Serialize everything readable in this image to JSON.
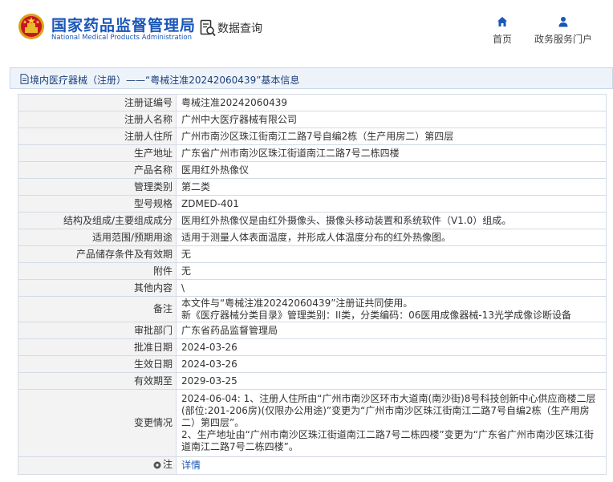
{
  "header": {
    "logo_cn": "国家药品监督管理局",
    "logo_en": "National Medical Products Administration",
    "query_label": "数据查询",
    "nav": [
      {
        "label": "首页",
        "icon": "home-icon"
      },
      {
        "label": "政务服务门户",
        "icon": "user-icon"
      }
    ]
  },
  "breadcrumb": {
    "text": "境内医疗器械（注册）——“粤械注准20242060439”基本信息",
    "icon": "document-icon"
  },
  "colors": {
    "brand": "#1a56b8",
    "crumb_bg": "#eef3fa",
    "key_bg": "#f3f3f3"
  },
  "rows": [
    {
      "key": "注册证编号",
      "value": "粤械注准20242060439"
    },
    {
      "key": "注册人名称",
      "value": "广州中大医疗器械有限公司"
    },
    {
      "key": "注册人住所",
      "value": "广州市南沙区珠江街南江二路7号自编2栋（生产用房二）第四层"
    },
    {
      "key": "生产地址",
      "value": "广东省广州市南沙区珠江街道南江二路7号二栋四楼"
    },
    {
      "key": "产品名称",
      "value": "医用红外热像仪"
    },
    {
      "key": "管理类别",
      "value": "第二类"
    },
    {
      "key": "型号规格",
      "value": "ZDMED-401"
    },
    {
      "key": "结构及组成/主要组成成分",
      "value": "医用红外热像仪是由红外摄像头、摄像头移动装置和系统软件（V1.0）组成。"
    },
    {
      "key": "适用范围/预期用途",
      "value": "适用于测量人体表面温度，并形成人体温度分布的红外热像图。"
    },
    {
      "key": "产品储存条件及有效期",
      "value": "无"
    },
    {
      "key": "附件",
      "value": "无"
    },
    {
      "key": "其他内容",
      "value": "\\"
    },
    {
      "key": "备注",
      "value": "本文件与“粤械注准20242060439”注册证共同使用。",
      "value2": "新《医疗器械分类目录》管理类别：II类，分类编码：06医用成像器械-13光学成像诊断设备"
    },
    {
      "key": "审批部门",
      "value": "广东省药品监督管理局"
    },
    {
      "key": "批准日期",
      "value": "2024-03-26"
    },
    {
      "key": "生效日期",
      "value": "2024-03-26"
    },
    {
      "key": "有效期至",
      "value": "2029-03-25"
    },
    {
      "key": "变更情况",
      "value": "2024-06-04: 1、注册人住所由“广州市南沙区环市大道南(南沙街)8号科技创新中心供应商楼二层(部位:201-206房)(仅限办公用途)”变更为“广州市南沙区珠江街南江二路7号自编2栋（生产用房二）第四层”。",
      "value2": "2、生产地址由“广州市南沙区珠江街道南江二路7号二栋四楼”变更为“广东省广州市南沙区珠江街道南江二路7号二栋四楼”。"
    },
    {
      "key": "注",
      "value": "详情",
      "icon": "pin-icon"
    }
  ]
}
